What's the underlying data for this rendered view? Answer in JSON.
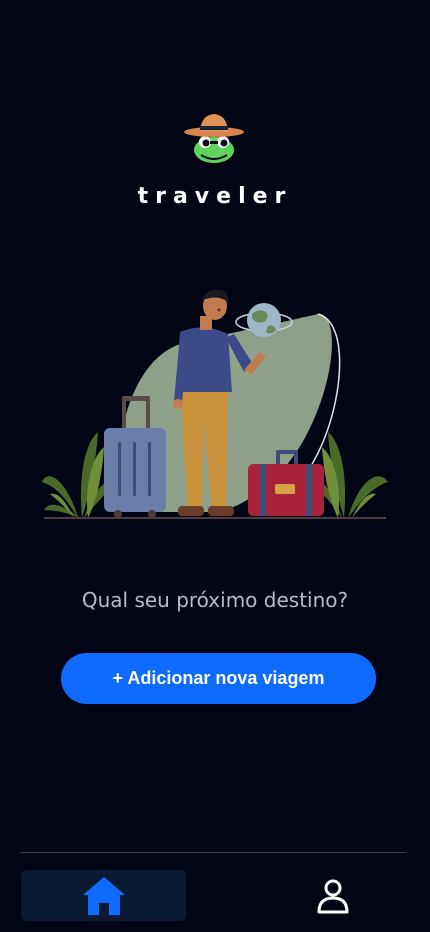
{
  "app": {
    "brand": "traveler"
  },
  "main": {
    "prompt": "Qual seu próximo destino?",
    "add_trip_label": "+ Adicionar nova viagem"
  },
  "icons": {
    "logo": "frog-with-hat-logo",
    "hero": "traveler-with-luggage-illustration",
    "home": "home-icon",
    "profile": "user-icon"
  },
  "bottom_nav": {
    "active": "home"
  },
  "colors": {
    "background": "#020614",
    "accent": "#0f6bfd",
    "active_tab_bg": "#0a1a33",
    "text_muted": "#b8bcc4"
  }
}
